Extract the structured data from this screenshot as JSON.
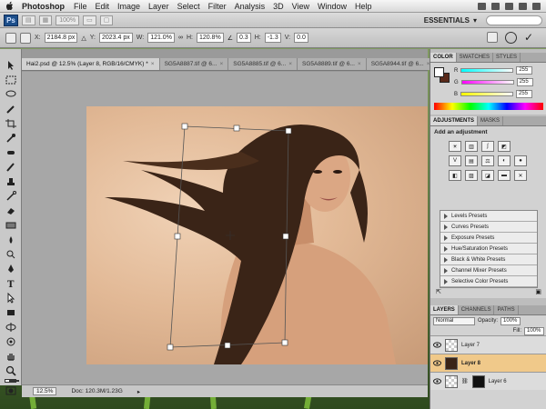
{
  "menubar": {
    "app_name": "Photoshop",
    "items": [
      "File",
      "Edit",
      "Image",
      "Layer",
      "Select",
      "Filter",
      "Analysis",
      "3D",
      "View",
      "Window",
      "Help"
    ]
  },
  "appbar": {
    "logo": "Ps",
    "zoom": "100%",
    "workspace": "ESSENTIALS"
  },
  "options": {
    "x_label": "X:",
    "x_value": "2184.8 px",
    "y_label": "Y:",
    "y_value": "2023.4 px",
    "w_label": "W:",
    "w_value": "121.0%",
    "h_label": "H:",
    "h_value": "120.8%",
    "angle_value": "0.3",
    "hskew_label": "H:",
    "hskew_value": "-1.3",
    "vskew_label": "V:",
    "vskew_value": "0.0"
  },
  "tabs": [
    {
      "label": "Hai2.psd @ 12.5% (Layer 8, RGB/16/CMYK) *",
      "active": true
    },
    {
      "label": "SG5A8887.tif @ 6...",
      "active": false
    },
    {
      "label": "SG5A8885.tif @ 6...",
      "active": false
    },
    {
      "label": "SG5A8889.tif @ 6...",
      "active": false
    },
    {
      "label": "SG5A8944.tif @ 6...",
      "active": false
    }
  ],
  "status": {
    "zoom": "12.5%",
    "doc": "Doc: 120.3M/1.23G"
  },
  "color_panel": {
    "tabs": [
      "COLOR",
      "SWATCHES",
      "STYLES"
    ],
    "r_value": "255",
    "g_value": "255",
    "b_value": "255"
  },
  "adjustments": {
    "tabs": [
      "ADJUSTMENTS",
      "MASKS"
    ],
    "heading": "Add an adjustment",
    "presets": [
      "Levels Presets",
      "Curves Presets",
      "Exposure Presets",
      "Hue/Saturation Presets",
      "Black & White Presets",
      "Channel Mixer Presets",
      "Selective Color Presets"
    ]
  },
  "layers": {
    "tabs": [
      "LAYERS",
      "CHANNELS",
      "PATHS"
    ],
    "blend_mode": "Normal",
    "opacity_label": "Opacity:",
    "opacity_value": "100%",
    "fill_label": "Fill:",
    "fill_value": "100%",
    "rows": [
      {
        "name": "Layer 7",
        "selected": false,
        "has_mask": false
      },
      {
        "name": "Layer 8",
        "selected": true,
        "has_mask": false
      },
      {
        "name": "Layer 6",
        "selected": false,
        "has_mask": true
      }
    ]
  },
  "colors": {
    "selection_highlight": "#f0c98a",
    "ps_blue": "#1c4e8a"
  }
}
